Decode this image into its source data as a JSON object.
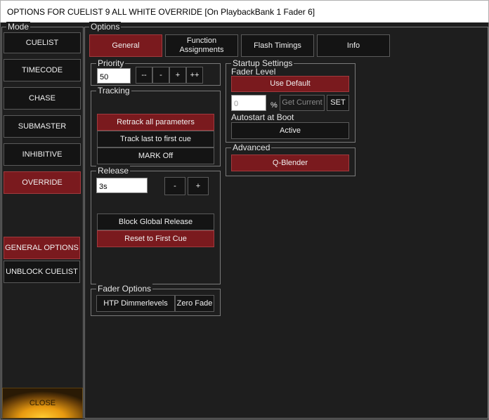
{
  "window": {
    "title": "OPTIONS FOR CUELIST 9 ALL WHITE OVERRIDE  [On PlaybackBank 1 Fader 6]"
  },
  "mode": {
    "legend": "Mode",
    "buttons": [
      {
        "label": "CUELIST",
        "selected": false
      },
      {
        "label": "TIMECODE",
        "selected": false
      },
      {
        "label": "CHASE",
        "selected": false
      },
      {
        "label": "SUBMASTER",
        "selected": false
      },
      {
        "label": "INHIBITIVE",
        "selected": false
      },
      {
        "label": "OVERRIDE",
        "selected": true
      }
    ],
    "general_options_label": "GENERAL OPTIONS",
    "unblock_label": "UNBLOCK CUELIST",
    "close_label": "CLOSE"
  },
  "options": {
    "legend": "Options",
    "tabs": [
      {
        "label": "General",
        "selected": true
      },
      {
        "label": "Function Assignments",
        "selected": false
      },
      {
        "label": "Flash Timings",
        "selected": false
      },
      {
        "label": "Info",
        "selected": false
      }
    ],
    "priority": {
      "legend": "Priority",
      "value": "50",
      "dec_big": "--",
      "dec": "-",
      "inc": "+",
      "inc_big": "++"
    },
    "tracking": {
      "legend": "Tracking",
      "retrack": "Retrack all parameters",
      "track_last": "Track last to first cue",
      "mark": "MARK Off"
    },
    "release": {
      "legend": "Release",
      "value": "3s",
      "dec": "-",
      "inc": "+",
      "block_global": "Block Global Release",
      "reset_first": "Reset to First Cue"
    },
    "fader_options": {
      "legend": "Fader Options",
      "htp": "HTP Dimmerlevels",
      "zero_fade": "Zero Fade"
    },
    "startup": {
      "legend": "Startup Settings",
      "fader_level_label": "Fader Level",
      "use_default": "Use Default",
      "level_value": "0",
      "percent": "%",
      "get_current": "Get Current",
      "set": "SET",
      "autostart_label": "Autostart at Boot",
      "autostart_value": "Active"
    },
    "advanced": {
      "legend": "Advanced",
      "q_blender": "Q-Blender"
    }
  },
  "colors": {
    "accent_red": "#7a1a1e",
    "background": "#1e1e1e"
  }
}
